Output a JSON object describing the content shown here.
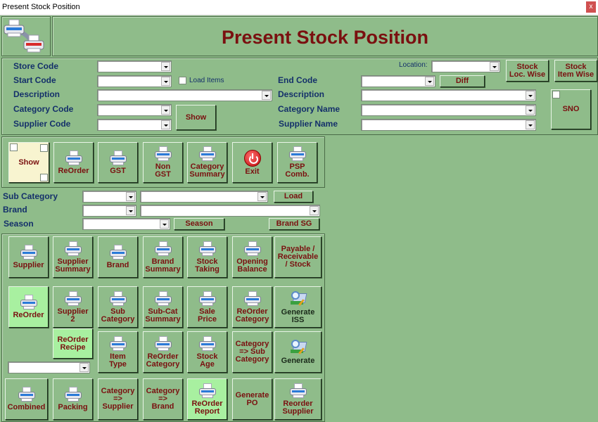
{
  "window": {
    "title": "Present Stock Position",
    "close_label": "x"
  },
  "header": {
    "title": "Present Stock Position",
    "logo_icon": "printer-network-icon"
  },
  "colors": {
    "background": "#8fbc8a",
    "title_text": "#7a1010",
    "label_text": "#14306a",
    "highlight_button": "#a8f0a0",
    "cream_button": "#f8f4d0"
  },
  "filters": {
    "store_code_label": "Store Code",
    "start_code_label": "Start Code",
    "description_label": "Description",
    "category_code_label": "Category Code",
    "supplier_code_label": "Supplier Code",
    "load_items_label": "Load Items",
    "show_label": "Show",
    "location_label": "Location:",
    "end_code_label": "End Code",
    "diff_label": "Diff",
    "description2_label": "Description",
    "category_name_label": "Category Name",
    "supplier_name_label": "Supplier Name",
    "stock_loc_wise_label": "Stock\nLoc. Wise",
    "stock_item_wise_label": "Stock\nItem Wise",
    "sno_label": "SNO",
    "store_code_value": "",
    "start_code_value": "",
    "description_value": "",
    "category_code_value": "",
    "supplier_code_value": "",
    "location_value": "",
    "end_code_value": "",
    "description2_value": "",
    "category_name_value": "",
    "supplier_name_value": ""
  },
  "toolbar": {
    "show_label": "Show",
    "buttons": [
      {
        "label": "ReOrder",
        "icon": "printer-icon"
      },
      {
        "label": "GST",
        "icon": "printer-icon"
      },
      {
        "label": "Non\nGST",
        "icon": "printer-icon"
      },
      {
        "label": "Category\nSummary",
        "icon": "printer-icon"
      },
      {
        "label": "Exit",
        "icon": "power-icon"
      },
      {
        "label": "PSP\nComb.",
        "icon": "printer-icon"
      }
    ]
  },
  "subfilters": {
    "sub_category_label": "Sub Category",
    "brand_label": "Brand",
    "season_label": "Season",
    "load_label": "Load",
    "season_button_label": "Season",
    "brand_sg_label": "Brand SG"
  },
  "reports": {
    "row1": [
      {
        "label": "Supplier",
        "icon": "printer-icon"
      },
      {
        "label": "Supplier\nSummary",
        "icon": "printer-icon"
      },
      {
        "label": "Brand",
        "icon": "printer-icon"
      },
      {
        "label": "Brand\nSummary",
        "icon": "printer-icon"
      },
      {
        "label": "Stock\nTaking",
        "icon": "printer-icon"
      },
      {
        "label": "Opening\nBalance",
        "icon": "printer-icon"
      },
      {
        "label": "Payable /\nReceivable\n/ Stock",
        "icon": ""
      }
    ],
    "row2": [
      {
        "label": "ReOrder",
        "icon": "printer-icon"
      },
      {
        "label": "Supplier\n2",
        "icon": "printer-icon"
      },
      {
        "label": "Sub\nCategory",
        "icon": "printer-icon"
      },
      {
        "label": "Sub-Cat\nSummary",
        "icon": "printer-icon"
      },
      {
        "label": "Sale\nPrice",
        "icon": "printer-icon"
      },
      {
        "label": "ReOrder\nCategory",
        "icon": "printer-icon"
      },
      {
        "label": "Generate\nISS",
        "icon": "generate-icon"
      }
    ],
    "row3": [
      {
        "label": "ReOrder\nRecipe",
        "icon": ""
      },
      {
        "label": "Item\nType",
        "icon": "printer-icon"
      },
      {
        "label": "ReOrder\nCategory",
        "icon": "printer-icon"
      },
      {
        "label": "Stock\nAge",
        "icon": "printer-icon"
      },
      {
        "label": "Category\n=> Sub\nCategory",
        "icon": ""
      },
      {
        "label": "Generate",
        "icon": "generate-icon"
      }
    ],
    "row4": [
      {
        "label": "Combined",
        "icon": "printer-icon"
      },
      {
        "label": "Packing",
        "icon": "printer-icon"
      },
      {
        "label": "Category\n=>\nSupplier",
        "icon": ""
      },
      {
        "label": "Category\n=>\nBrand",
        "icon": ""
      },
      {
        "label": "ReOrder\nReport",
        "icon": "printer-icon"
      },
      {
        "label": "Generate\nPO",
        "icon": ""
      },
      {
        "label": "Reorder\nSupplier",
        "icon": "printer-icon"
      }
    ],
    "misc_combo_value": ""
  }
}
